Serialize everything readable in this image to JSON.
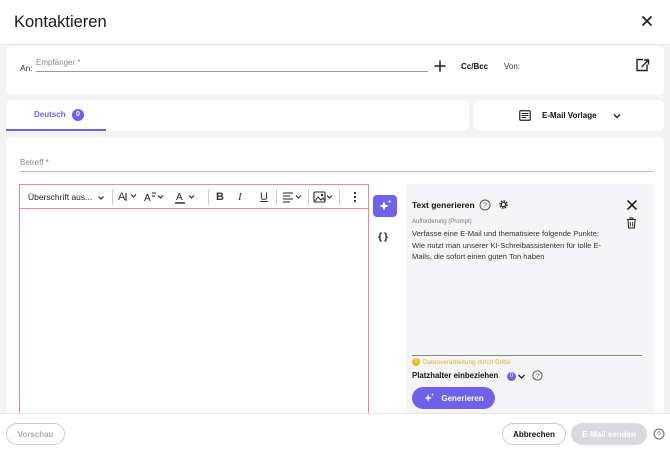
{
  "header": {
    "title": "Kontaktieren"
  },
  "recipients": {
    "to_label": "An:",
    "recipient_placeholder": "Empfänger *",
    "cc_bcc_label": "Cc/Bcc",
    "from_label": "Von:"
  },
  "language_tabs": [
    {
      "label": "Deutsch",
      "count": "0",
      "active": true
    }
  ],
  "template": {
    "label": "E-Mail Vorlage"
  },
  "subject": {
    "label": "Betreff *"
  },
  "editor": {
    "toolbar": {
      "heading_select": "Überschrift aus...",
      "font_size_glyph": "A",
      "bold_glyph": "B",
      "italic_glyph": "I",
      "underline_glyph": "U"
    },
    "body": ""
  },
  "side_actions": {
    "placeholder_glyph": "{}"
  },
  "ai_panel": {
    "title": "Text generieren",
    "prompt_label": "Aufforderung (Prompt)",
    "prompt_text": "Verfasse eine E-Mail und thematisiere folgende Punkte: Wie nutzt man unserer KI-Schreibassistenten für tolle E-Mails, die sofort einen guten Ton haben",
    "data_notice": "Datenverarbeitung durch Dritte",
    "placeholder_label": "Platzhalter einbeziehen",
    "placeholder_count": "0",
    "generate_button": "Generieren"
  },
  "footer": {
    "preview_button": "Vorschau",
    "cancel_button": "Abbrechen",
    "send_button": "E-Mail senden"
  },
  "colors": {
    "accent": "#6f62e8",
    "editor_border": "#e58aa5",
    "warning": "#f0b920",
    "disabled": "#d9d9de"
  }
}
